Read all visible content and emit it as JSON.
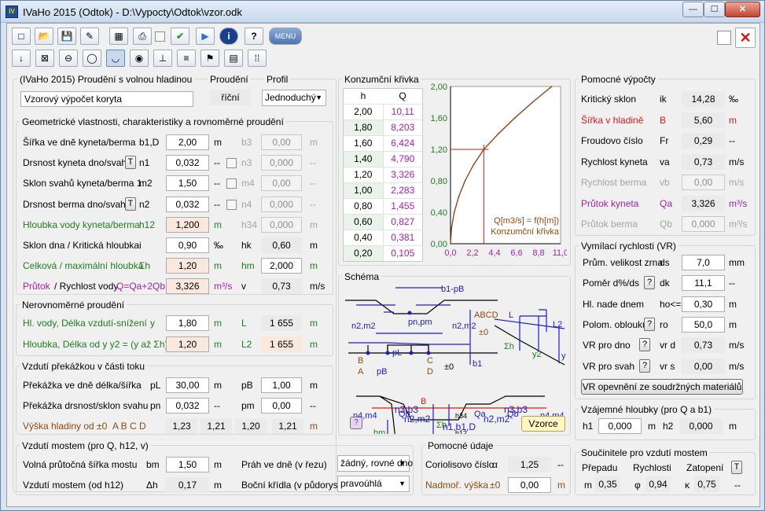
{
  "window": {
    "title": "IVaHo 2015 (Odtok) - D:\\Vypocty\\Odtok\\vzor.odk",
    "app_icon": "IV",
    "min": "—",
    "max": "☐",
    "close": "✕"
  },
  "toolbar": {
    "new": "□",
    "open": "📂",
    "save": "💾",
    "edit": "✎",
    "calc": "▦",
    "print": "⎙",
    "check": "✔",
    "run": "▶",
    "info": "i",
    "help": "?",
    "menu": "MENU"
  },
  "toolbar2": [
    "↓",
    "⊠",
    "⊖",
    "◯",
    "◡",
    "◉",
    "⊥",
    "≡",
    "⚑",
    "▤",
    "⁞⁞"
  ],
  "top_right": {
    "close_x": "✕"
  },
  "main": {
    "group_label": "(IVaHo 2015) Proudění s volnou hladinou",
    "description": "Vzorový výpočet koryta",
    "flow_label": "Proudění",
    "flow_value": "říční",
    "profile_label": "Profil",
    "profile_value": "Jednoduchý"
  },
  "geom": {
    "title": "Geometrické vlastnosti, charakteristiky a rovnoměrné proudění",
    "rows": [
      {
        "label": "Šířka ve dně  kyneta/berma",
        "sym": "b1,D",
        "val": "2,00",
        "unit": "m",
        "sym2": "b3",
        "val2": "0,00",
        "unit2": "m"
      },
      {
        "label": "Drsnost kyneta dno/svah",
        "btn": "T",
        "sym": "n1",
        "val": "0,032",
        "unit": "--",
        "sym2": "n3",
        "val2": "0,000",
        "unit2": "--"
      },
      {
        "label": "Sklon svahů kyneta/berma 1:",
        "sym": "m2",
        "val": "1,50",
        "unit": "--",
        "sym2": "m4",
        "val2": "0,00",
        "unit2": "--"
      },
      {
        "label": "Drsnost berma dno/svah",
        "btn": "T",
        "sym": "n2",
        "val": "0,032",
        "unit": "--",
        "sym2": "n4",
        "val2": "0,000",
        "unit2": "--"
      },
      {
        "label": "Hloubka vody  kyneta/berma",
        "sym": "h12",
        "val": "1,200",
        "unit": "m",
        "sym2": "h34",
        "val2": "0,000",
        "unit2": "m"
      },
      {
        "label": "Sklon dna / Kritická hloubka",
        "sym": "i",
        "val": "0,90",
        "unit": "‰",
        "sym2": "hk",
        "val2": "0,60",
        "unit2": "m"
      },
      {
        "label": "Celková / maximální hloubka",
        "sym": "Σh",
        "val": "1,20",
        "unit": "m",
        "sym2": "hm",
        "val2": "2,000",
        "unit2": "m"
      },
      {
        "label_a": "Průtok",
        "label_b": " / Rychlost vody",
        "sym": "Q=Qa+2Qb",
        "val": "3,326",
        "unit": "m³/s",
        "sym2": "v",
        "val2": "0,73",
        "unit2": "m/s"
      }
    ]
  },
  "nerov": {
    "title": "Nerovnoměrné proudění",
    "r1": {
      "label": "Hl. vody, Délka vzdutí-snížení",
      "sym": "y",
      "val": "1,80",
      "unit": "m",
      "sym2": "L",
      "val2": "1 655",
      "unit2": "m"
    },
    "r2": {
      "label": "Hloubka, Délka od y    y2 = (y až Σh)",
      "val": "1,20",
      "unit": "m",
      "sym2": "L2",
      "val2": "1 655",
      "unit2": "m"
    }
  },
  "prek": {
    "title": "Vzdutí překážkou v části toku",
    "r1": {
      "label": "Překážka ve dně délka/šířka",
      "sym": "pL",
      "val": "30,00",
      "unit": "m",
      "sym2": "pB",
      "val2": "1,00",
      "unit2": "m"
    },
    "r2": {
      "label": "Překážka drsnost/sklon svahu",
      "sym": "pn",
      "val": "0,032",
      "unit": "--",
      "sym2": "pm",
      "val2": "0,00",
      "unit2": "--"
    },
    "r3": {
      "label": "Výška hladiny od  ±0",
      "letters": "A  B  C  D",
      "a": "1,23",
      "b": "1,21",
      "c": "1,20",
      "d": "1,21",
      "unit": "m"
    }
  },
  "most": {
    "title": "Vzdutí mostem (pro Q, h12, v)",
    "r1": {
      "label": "Volná průtočná šířka mostu",
      "sym": "bm",
      "val": "1,50",
      "unit": "m"
    },
    "r2": {
      "label": "Vzdutí mostem (od h12)",
      "sym": "Δh",
      "val": "0,17",
      "unit": "m"
    },
    "prah_label": "Práh ve dně  (v řezu)",
    "prah_value": "žádný, rovné dno",
    "kridla_label": "Boční křídla (v půdorysu)",
    "kridla_value": "pravoúhlá"
  },
  "konz": {
    "title": "Konzumční křivka",
    "col_h": "h",
    "col_q": "Q",
    "rows": [
      [
        "2,00",
        "10,11"
      ],
      [
        "1,80",
        "8,203"
      ],
      [
        "1,60",
        "6,424"
      ],
      [
        "1,40",
        "4,790"
      ],
      [
        "1,20",
        "3,326"
      ],
      [
        "1,00",
        "2,283"
      ],
      [
        "0,80",
        "1,455"
      ],
      [
        "0,60",
        "0,827"
      ],
      [
        "0,40",
        "0,381"
      ],
      [
        "0,20",
        "0,105"
      ]
    ]
  },
  "chart_data": {
    "type": "line",
    "title": "",
    "xlabel": "",
    "ylabel": "",
    "x_ticks": [
      "0,0",
      "2,2",
      "4,4",
      "6,6",
      "8,8",
      "11,0"
    ],
    "y_ticks": [
      "0,00",
      "0,40",
      "0,80",
      "1,20",
      "1,60",
      "2,00"
    ],
    "xlim": [
      0,
      11
    ],
    "ylim": [
      0,
      2
    ],
    "series": [
      {
        "name": "",
        "x": [
          0,
          0.105,
          0.381,
          0.827,
          1.455,
          2.283,
          3.326,
          4.79,
          6.424,
          8.203,
          10.11
        ],
        "y": [
          0,
          0.2,
          0.4,
          0.6,
          0.8,
          1.0,
          1.2,
          1.4,
          1.6,
          1.8,
          2.0
        ]
      }
    ],
    "marker": {
      "x": 3.326,
      "y": 1.2
    },
    "annotation_1": "Q[m3/s] = f(h[m])",
    "annotation_2": "Konzumční křivka",
    "colors": {
      "curve": "#8b3a0c",
      "marker": "#d21919"
    },
    "grid": false
  },
  "schema": {
    "title": "Schéma",
    "t1": "b1-pB",
    "t2": "ABCD",
    "t3": "±0",
    "t4": "pn,pm",
    "t5": "n2,m2",
    "t6": "n2,m2",
    "t7": "pL",
    "t8": "B",
    "t9": "C",
    "t10": "A",
    "t11": "D",
    "t12": "pB",
    "t13": "±0",
    "t14": "b1",
    "t15": "L",
    "t16": "L2",
    "t17": "Σh",
    "t18": "y2",
    "t19": "y",
    "t20": "B",
    "t21": "Qb",
    "t22": "Qa",
    "t23": "Qb",
    "t24": "n4,m4",
    "t25": "n4,m4",
    "t26": "hm",
    "t27": "Σh",
    "t28": "h34",
    "t29": "h12",
    "t30": "n3,b3",
    "t31": "n3,b3",
    "t32": "n2,m2",
    "t33": "n2,m2",
    "t34": "n1,b1,D",
    "help": "?",
    "vzorce": "Vzorce"
  },
  "pomocne": {
    "title": "Pomocné výpočty",
    "rows": [
      {
        "label": "Kritický sklon",
        "sym": "ik",
        "val": "14,28",
        "unit": "‰"
      },
      {
        "label": "Šířka v hladině",
        "sym": "B",
        "val": "5,60",
        "unit": "m"
      },
      {
        "label": "Froudovo číslo",
        "sym": "Fr",
        "val": "0,29",
        "unit": "--"
      },
      {
        "label": "Rychlost kyneta",
        "sym": "va",
        "val": "0,73",
        "unit": "m/s"
      },
      {
        "label": "Rychlost berma",
        "sym": "vb",
        "val": "0,00",
        "unit": "m/s"
      },
      {
        "label": "Průtok kyneta",
        "sym": "Qa",
        "val": "3,326",
        "unit": "m³/s"
      },
      {
        "label": "Průtok berma",
        "sym": "Qb",
        "val": "0,000",
        "unit": "m³/s"
      }
    ]
  },
  "vymil": {
    "title": "Vymílací rychlosti (VR)",
    "rows": [
      {
        "label": "Prům. velikost zrna",
        "sym": "ds",
        "val": "7,0",
        "unit": "mm"
      },
      {
        "label": "Poměr d%/ds",
        "btn": "?",
        "sym": "dk",
        "val": "11,1",
        "unit": "--"
      },
      {
        "label": "Hl. nade dnem",
        "sym": "ho<=Σh",
        "val": "0,30",
        "unit": "m"
      },
      {
        "label": "Polom. oblouku",
        "btn": "?",
        "sym": "ro",
        "val": "50,0",
        "unit": "m"
      },
      {
        "label": "VR pro dno",
        "btn": "?",
        "sym": "vr d",
        "val": "0,73",
        "unit": "m/s"
      },
      {
        "label": "VR pro svah",
        "btn": "?",
        "sym": "vr s",
        "val": "0,00",
        "unit": "m/s"
      }
    ],
    "button": "VR opevnění ze soudržných materiálů"
  },
  "vzajemne": {
    "title": "Vzájemné hloubky (pro Q a b1)",
    "h1": "h1",
    "h1_val": "0,000",
    "unit1": "m",
    "h2": "h2",
    "h2_val": "0,000",
    "unit2": "m"
  },
  "pomud": {
    "title": "Pomocné údaje",
    "r1": {
      "label": "Coriolisovo číslo",
      "sym": "α",
      "val": "1,25",
      "unit": "--"
    },
    "r2": {
      "label": "Nadmoř. výška",
      "sym": "±0",
      "val": "0,00",
      "unit": "m"
    }
  },
  "souc": {
    "title": "Součinitele pro vzdutí mostem",
    "c1": "Přepadu",
    "c2": "Rychlosti",
    "c3": "Zatopení",
    "btn": "T",
    "s1": "m",
    "v1": "0,35",
    "s2": "φ",
    "v2": "0,94",
    "s3": "κ",
    "v3": "0,75",
    "dash": "--"
  }
}
